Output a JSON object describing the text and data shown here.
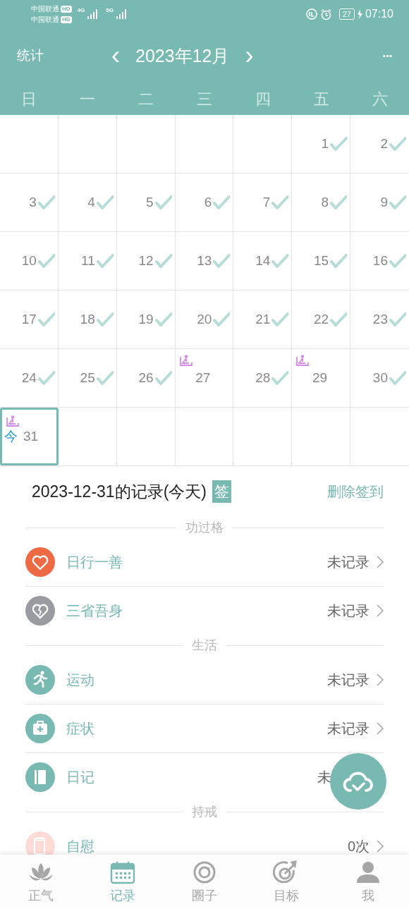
{
  "status_bar": {
    "carriers": [
      {
        "name": "中国联通",
        "badge": "HD"
      },
      {
        "name": "中国联通",
        "badge": "HD"
      }
    ],
    "networks": [
      "4G",
      "5G"
    ],
    "battery": "27",
    "time": "07:10"
  },
  "header": {
    "stats": "统计",
    "prev": "‹",
    "month": "2023年12月",
    "next": "›",
    "more": "···"
  },
  "weekdays": [
    "日",
    "一",
    "二",
    "三",
    "四",
    "五",
    "六"
  ],
  "calendar": [
    {
      "kind": "empty"
    },
    {
      "kind": "empty"
    },
    {
      "kind": "empty"
    },
    {
      "kind": "empty"
    },
    {
      "kind": "empty"
    },
    {
      "kind": "day",
      "label": "1",
      "checked": true,
      "marked": false,
      "selected": false
    },
    {
      "kind": "day",
      "label": "2",
      "checked": true,
      "marked": false,
      "selected": false
    },
    {
      "kind": "day",
      "label": "3",
      "checked": true,
      "marked": false,
      "selected": false
    },
    {
      "kind": "day",
      "label": "4",
      "checked": true,
      "marked": false,
      "selected": false
    },
    {
      "kind": "day",
      "label": "5",
      "checked": true,
      "marked": false,
      "selected": false
    },
    {
      "kind": "day",
      "label": "6",
      "checked": true,
      "marked": false,
      "selected": false
    },
    {
      "kind": "day",
      "label": "7",
      "checked": true,
      "marked": false,
      "selected": false
    },
    {
      "kind": "day",
      "label": "8",
      "checked": true,
      "marked": false,
      "selected": false
    },
    {
      "kind": "day",
      "label": "9",
      "checked": true,
      "marked": false,
      "selected": false
    },
    {
      "kind": "day",
      "label": "10",
      "checked": true,
      "marked": false,
      "selected": false
    },
    {
      "kind": "day",
      "label": "11",
      "checked": true,
      "marked": false,
      "selected": false
    },
    {
      "kind": "day",
      "label": "12",
      "checked": true,
      "marked": false,
      "selected": false
    },
    {
      "kind": "day",
      "label": "13",
      "checked": true,
      "marked": false,
      "selected": false
    },
    {
      "kind": "day",
      "label": "14",
      "checked": true,
      "marked": false,
      "selected": false
    },
    {
      "kind": "day",
      "label": "15",
      "checked": true,
      "marked": false,
      "selected": false
    },
    {
      "kind": "day",
      "label": "16",
      "checked": true,
      "marked": false,
      "selected": false
    },
    {
      "kind": "day",
      "label": "17",
      "checked": true,
      "marked": false,
      "selected": false
    },
    {
      "kind": "day",
      "label": "18",
      "checked": true,
      "marked": false,
      "selected": false
    },
    {
      "kind": "day",
      "label": "19",
      "checked": true,
      "marked": false,
      "selected": false
    },
    {
      "kind": "day",
      "label": "20",
      "checked": true,
      "marked": false,
      "selected": false
    },
    {
      "kind": "day",
      "label": "21",
      "checked": true,
      "marked": false,
      "selected": false
    },
    {
      "kind": "day",
      "label": "22",
      "checked": true,
      "marked": false,
      "selected": false
    },
    {
      "kind": "day",
      "label": "23",
      "checked": true,
      "marked": false,
      "selected": false
    },
    {
      "kind": "day",
      "label": "24",
      "checked": true,
      "marked": false,
      "selected": false
    },
    {
      "kind": "day",
      "label": "25",
      "checked": true,
      "marked": false,
      "selected": false
    },
    {
      "kind": "day",
      "label": "26",
      "checked": true,
      "marked": false,
      "selected": false
    },
    {
      "kind": "day",
      "label": "27",
      "checked": false,
      "marked": true,
      "selected": false
    },
    {
      "kind": "day",
      "label": "28",
      "checked": true,
      "marked": false,
      "selected": false
    },
    {
      "kind": "day",
      "label": "29",
      "checked": false,
      "marked": true,
      "selected": false
    },
    {
      "kind": "day",
      "label": "30",
      "checked": true,
      "marked": false,
      "selected": false
    },
    {
      "kind": "day",
      "label": "31",
      "today": "今",
      "checked": false,
      "marked": true,
      "selected": true
    },
    {
      "kind": "empty"
    },
    {
      "kind": "empty"
    },
    {
      "kind": "empty"
    },
    {
      "kind": "empty"
    },
    {
      "kind": "empty"
    },
    {
      "kind": "empty"
    }
  ],
  "record": {
    "title": "2023-12-31的记录(今天)",
    "badge": "签",
    "action": "删除签到",
    "groups": [
      {
        "title": "功过格",
        "items": [
          {
            "kind": "heart",
            "color": "#ee6a45",
            "label": "日行一善",
            "value": "未记录",
            "chevron": true
          },
          {
            "kind": "broken-heart",
            "color": "#9a9ba1",
            "label": "三省吾身",
            "value": "未记录",
            "chevron": true
          }
        ]
      },
      {
        "title": "生活",
        "items": [
          {
            "kind": "runner",
            "color": "#78b9b2",
            "label": "运动",
            "value": "未记录",
            "chevron": true
          },
          {
            "kind": "medkit",
            "color": "#78b9b2",
            "label": "症状",
            "value": "未记录",
            "chevron": true
          },
          {
            "kind": "book",
            "color": "#78b9b2",
            "label": "日记",
            "value": "未",
            "chevron": false
          }
        ]
      },
      {
        "title": "持戒",
        "items": [
          {
            "kind": "tissue",
            "color": "#fddcd8",
            "label": "自慰",
            "value": "0次",
            "chevron": true
          }
        ]
      }
    ]
  },
  "nav": [
    {
      "kind": "lotus",
      "label": "正气",
      "selected": false
    },
    {
      "kind": "calendar",
      "label": "记录",
      "selected": true
    },
    {
      "kind": "ring",
      "label": "圈子",
      "selected": false
    },
    {
      "kind": "target",
      "label": "目标",
      "selected": false
    },
    {
      "kind": "person",
      "label": "我",
      "selected": false
    }
  ]
}
